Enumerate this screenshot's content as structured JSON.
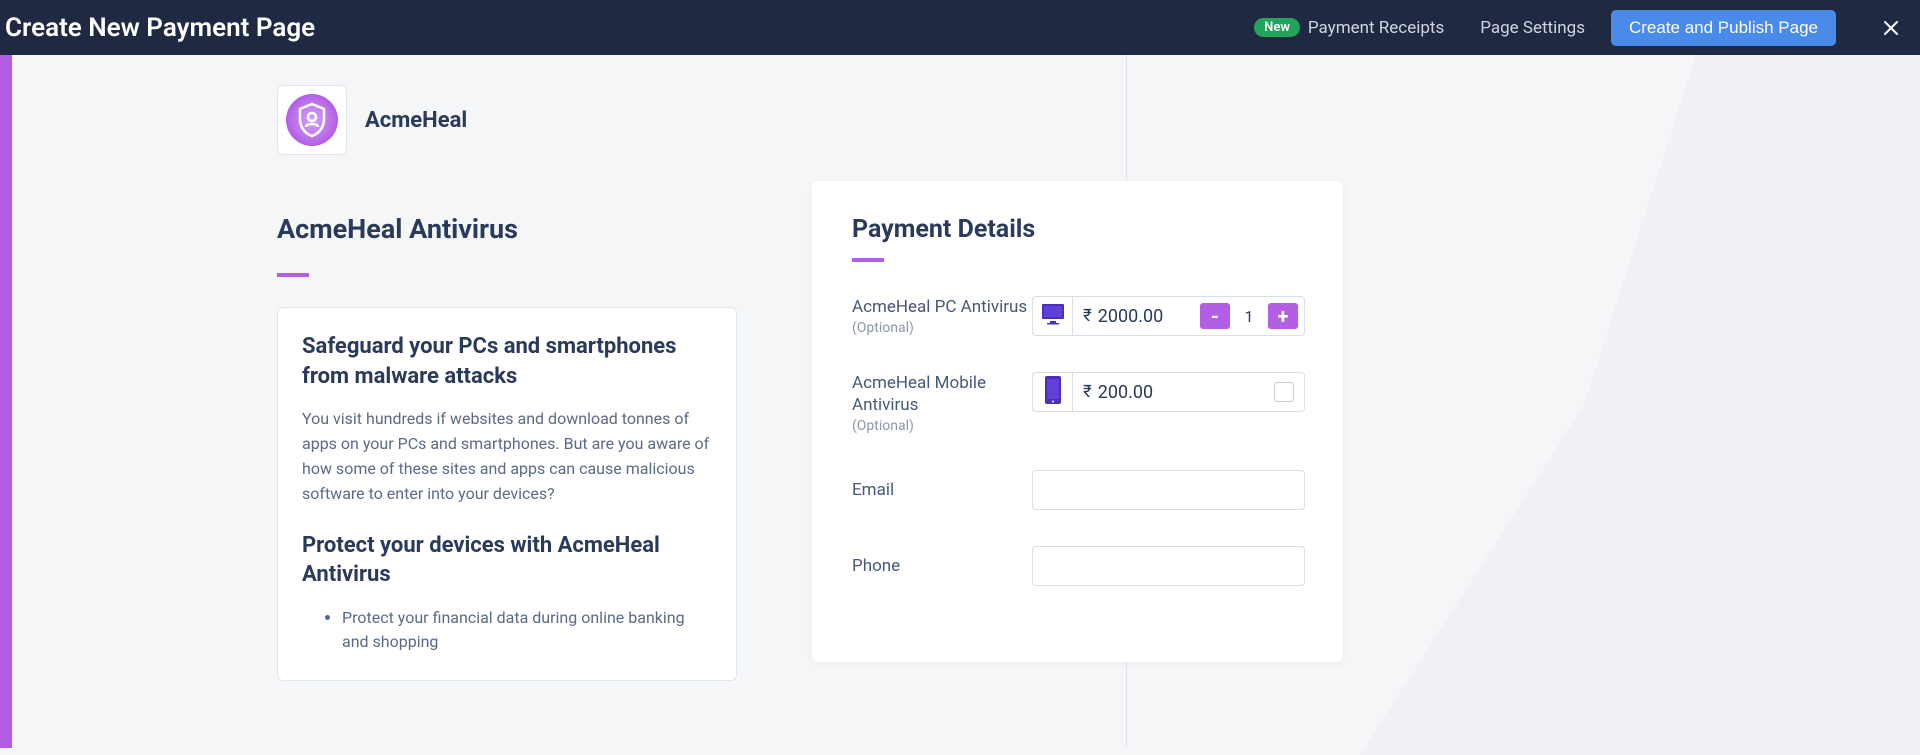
{
  "header": {
    "title": "Create New Payment Page",
    "new_badge": "New",
    "payment_receipts": "Payment Receipts",
    "page_settings": "Page Settings",
    "create_publish": "Create and Publish Page"
  },
  "brand": {
    "name": "AcmeHeal"
  },
  "description": {
    "section_title": "AcmeHeal Antivirus",
    "h1": "Safeguard your PCs and smartphones from malware attacks",
    "p1": "You visit hundreds if websites and download tonnes of apps on your PCs and smartphones. But are you aware of how some of these sites and apps can cause malicious software to enter into your devices?",
    "h2": "Protect your devices with AcmeHeal Antivirus",
    "bullet1": "Protect your financial data during online banking and shopping"
  },
  "payment": {
    "title": "Payment Details",
    "currency": "₹",
    "items": [
      {
        "name": "AcmeHeal PC Antivirus",
        "optional": "(Optional)",
        "price": "2000.00",
        "qty": "1",
        "type": "stepper"
      },
      {
        "name": "AcmeHeal Mobile Antivirus",
        "optional": "(Optional)",
        "price": "200.00",
        "type": "checkbox"
      }
    ],
    "fields": {
      "email_label": "Email",
      "phone_label": "Phone"
    }
  }
}
